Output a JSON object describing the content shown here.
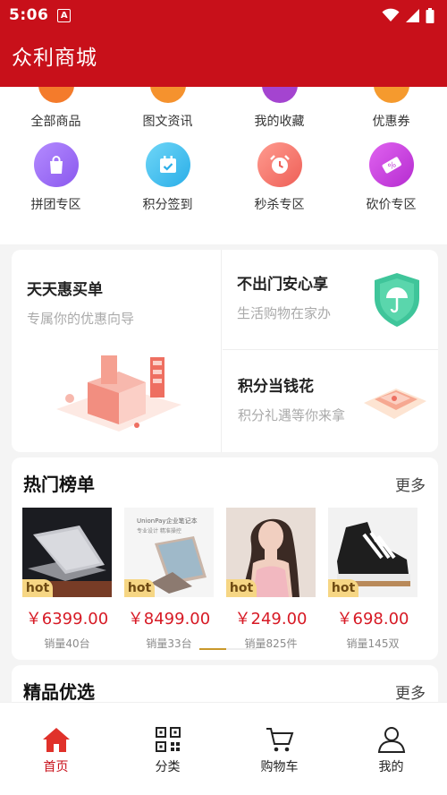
{
  "status": {
    "time": "5:06",
    "badge": "A"
  },
  "app": {
    "title": "众利商城"
  },
  "categories_row1": [
    {
      "label": "全部商品",
      "color": "#f47b2b"
    },
    {
      "label": "图文资讯",
      "color": "#f5922e"
    },
    {
      "label": "我的收藏",
      "color": "#a444d0"
    },
    {
      "label": "优惠券",
      "color": "#f59a2e"
    }
  ],
  "categories_row2": [
    {
      "label": "拼团专区",
      "icon": "shopping-bag-icon",
      "color": "#9b6bf2"
    },
    {
      "label": "积分签到",
      "icon": "calendar-check-icon",
      "color": "#3bb8ec"
    },
    {
      "label": "秒杀专区",
      "icon": "alarm-clock-icon",
      "color": "#f2716a"
    },
    {
      "label": "砍价专区",
      "icon": "ticket-icon",
      "color": "#c13fd6"
    }
  ],
  "promo": {
    "left": {
      "title": "天天惠买单",
      "subtitle": "专属你的优惠向导"
    },
    "right_top": {
      "title": "不出门安心享",
      "subtitle": "生活购物在家办"
    },
    "right_bottom": {
      "title": "积分当钱花",
      "subtitle": "积分礼遇等你来拿"
    }
  },
  "hot_section": {
    "title": "热门榜单",
    "more": "更多",
    "badge": "hot",
    "products": [
      {
        "price": "￥6399.00",
        "sold": "销量40台",
        "image": "laptop"
      },
      {
        "price": "￥8499.00",
        "sold": "销量33台",
        "image": "laptop-box"
      },
      {
        "price": "￥249.00",
        "sold": "销量825件",
        "image": "model-photo"
      },
      {
        "price": "￥698.00",
        "sold": "销量145双",
        "image": "sneaker"
      }
    ],
    "box_text_line1": "UnionPay企业笔记本",
    "box_text_line2": "专业设计 精准操控"
  },
  "featured_section": {
    "title": "精品优选",
    "more": "更多"
  },
  "tabs": [
    {
      "label": "首页",
      "icon": "home-icon",
      "active": true
    },
    {
      "label": "分类",
      "icon": "qr-grid-icon",
      "active": false
    },
    {
      "label": "购物车",
      "icon": "cart-icon",
      "active": false
    },
    {
      "label": "我的",
      "icon": "user-icon",
      "active": false
    }
  ],
  "colors": {
    "brand": "#c8101a",
    "price": "#d71a25",
    "badge_bg": "#f6d684"
  }
}
